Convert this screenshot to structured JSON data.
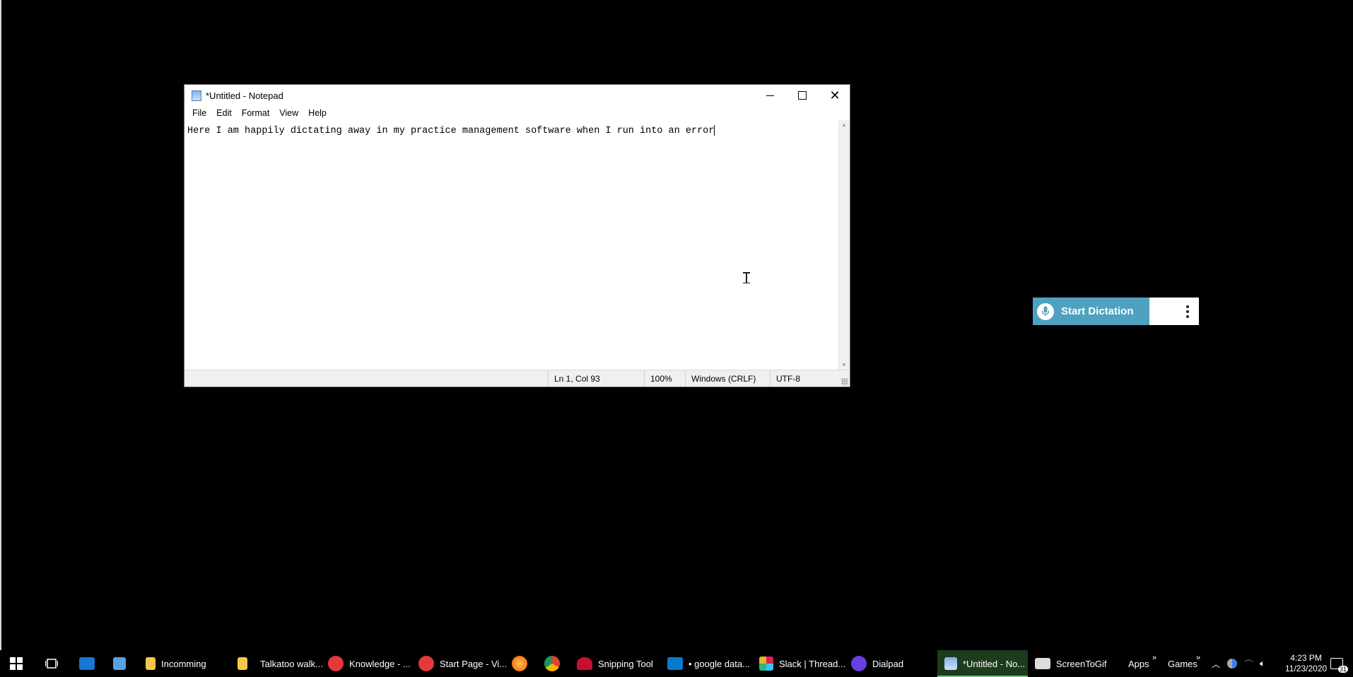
{
  "notepad": {
    "title": "*Untitled - Notepad",
    "menu": [
      "File",
      "Edit",
      "Format",
      "View",
      "Help"
    ],
    "content": "Here I am happily dictating away in my practice management software when I run into an error",
    "status": {
      "position": "Ln 1, Col 93",
      "zoom": "100%",
      "line_endings": "Windows (CRLF)",
      "encoding": "UTF-8"
    }
  },
  "dictation": {
    "label": "Start Dictation"
  },
  "taskbar": {
    "items": [
      {
        "label": "Incomming",
        "icon": "folder-icon"
      },
      {
        "label": "Talkatoo walk...",
        "icon": "folder-icon"
      },
      {
        "label": "Knowledge - ...",
        "icon": "vivaldi-icon"
      },
      {
        "label": "Start Page - Vi...",
        "icon": "vivaldi-icon"
      },
      {
        "label": "Snipping Tool",
        "icon": "snipping-tool-icon"
      },
      {
        "label": "• google data...",
        "icon": "vscode-icon"
      },
      {
        "label": "Slack | Thread...",
        "icon": "slack-icon"
      },
      {
        "label": "Dialpad",
        "icon": "dialpad-icon"
      },
      {
        "label": "*Untitled - No...",
        "icon": "notepad-icon"
      },
      {
        "label": "ScreenToGif",
        "icon": "screentogif-icon"
      }
    ],
    "toolbars": [
      "Apps",
      "Games"
    ],
    "time": "4:23 PM",
    "date": "11/23/2020",
    "notification_count": "31"
  },
  "colors": {
    "dictation_accent": "#4ea2bf",
    "taskbar_active_accent": "#6fc27b"
  }
}
